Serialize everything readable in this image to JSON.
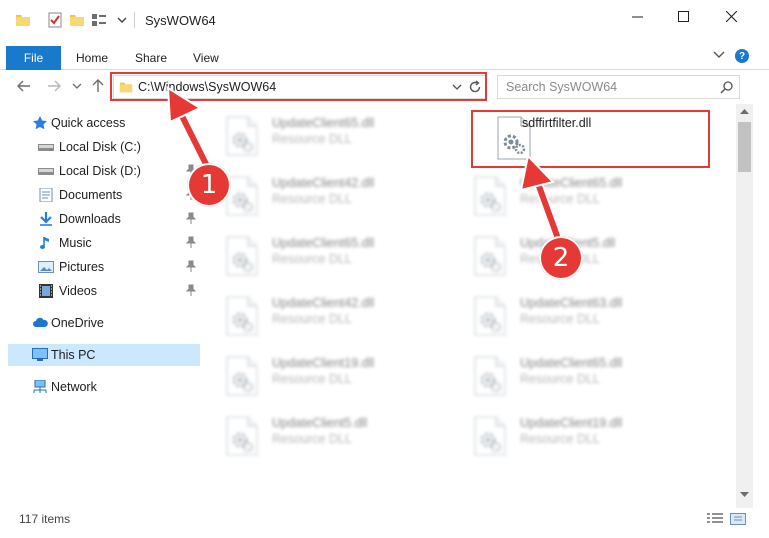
{
  "window": {
    "title": "SysWOW64"
  },
  "ribbon": {
    "tabs": [
      "File",
      "Home",
      "Share",
      "View"
    ],
    "help": "?"
  },
  "address": {
    "path": "C:\\Windows\\SysWOW64"
  },
  "search": {
    "placeholder": "Search SysWOW64"
  },
  "nav": {
    "items": [
      {
        "label": "Quick access",
        "icon": "star-icon",
        "pinned": false
      },
      {
        "label": "Local Disk (C:)",
        "icon": "drive-icon",
        "pinned": false
      },
      {
        "label": "Local Disk (D:)",
        "icon": "drive-icon",
        "pinned": true
      },
      {
        "label": "Documents",
        "icon": "documents-icon",
        "pinned": true
      },
      {
        "label": "Downloads",
        "icon": "download-arrow-icon",
        "pinned": true
      },
      {
        "label": "Music",
        "icon": "music-note-icon",
        "pinned": true
      },
      {
        "label": "Pictures",
        "icon": "pictures-icon",
        "pinned": true
      },
      {
        "label": "Videos",
        "icon": "film-icon",
        "pinned": true
      },
      {
        "label": "OneDrive",
        "icon": "cloud-icon",
        "pinned": false
      },
      {
        "label": "This PC",
        "icon": "monitor-icon",
        "pinned": false
      },
      {
        "label": "Network",
        "icon": "network-icon",
        "pinned": false
      }
    ]
  },
  "files": {
    "target": {
      "name": "sdffirtfilter.dll"
    },
    "left_column": [
      {
        "name": "UpdateClient65.dll",
        "type": "Resource DLL"
      },
      {
        "name": "UpdateClient42.dll",
        "type": "Resource DLL"
      },
      {
        "name": "UpdateClient65.dll",
        "type": "Resource DLL"
      },
      {
        "name": "UpdateClient42.dll",
        "type": "Resource DLL"
      },
      {
        "name": "UpdateClient19.dll",
        "type": "Resource DLL"
      },
      {
        "name": "UpdateClient5.dll",
        "type": "Resource DLL"
      }
    ],
    "right_column": [
      {
        "name": "UpdateClient65.dll",
        "type": "Resource DLL"
      },
      {
        "name": "UpdateClient5.dll",
        "type": "Resource DLL"
      },
      {
        "name": "UpdateClient63.dll",
        "type": "Resource DLL"
      },
      {
        "name": "UpdateClient65.dll",
        "type": "Resource DLL"
      },
      {
        "name": "UpdateClient19.dll",
        "type": "Resource DLL"
      }
    ]
  },
  "status": {
    "count": "117 items"
  },
  "callouts": [
    "1",
    "2"
  ],
  "colors": {
    "accent": "#1979ca",
    "highlight": "#e53935",
    "selection": "#cce8ff"
  }
}
